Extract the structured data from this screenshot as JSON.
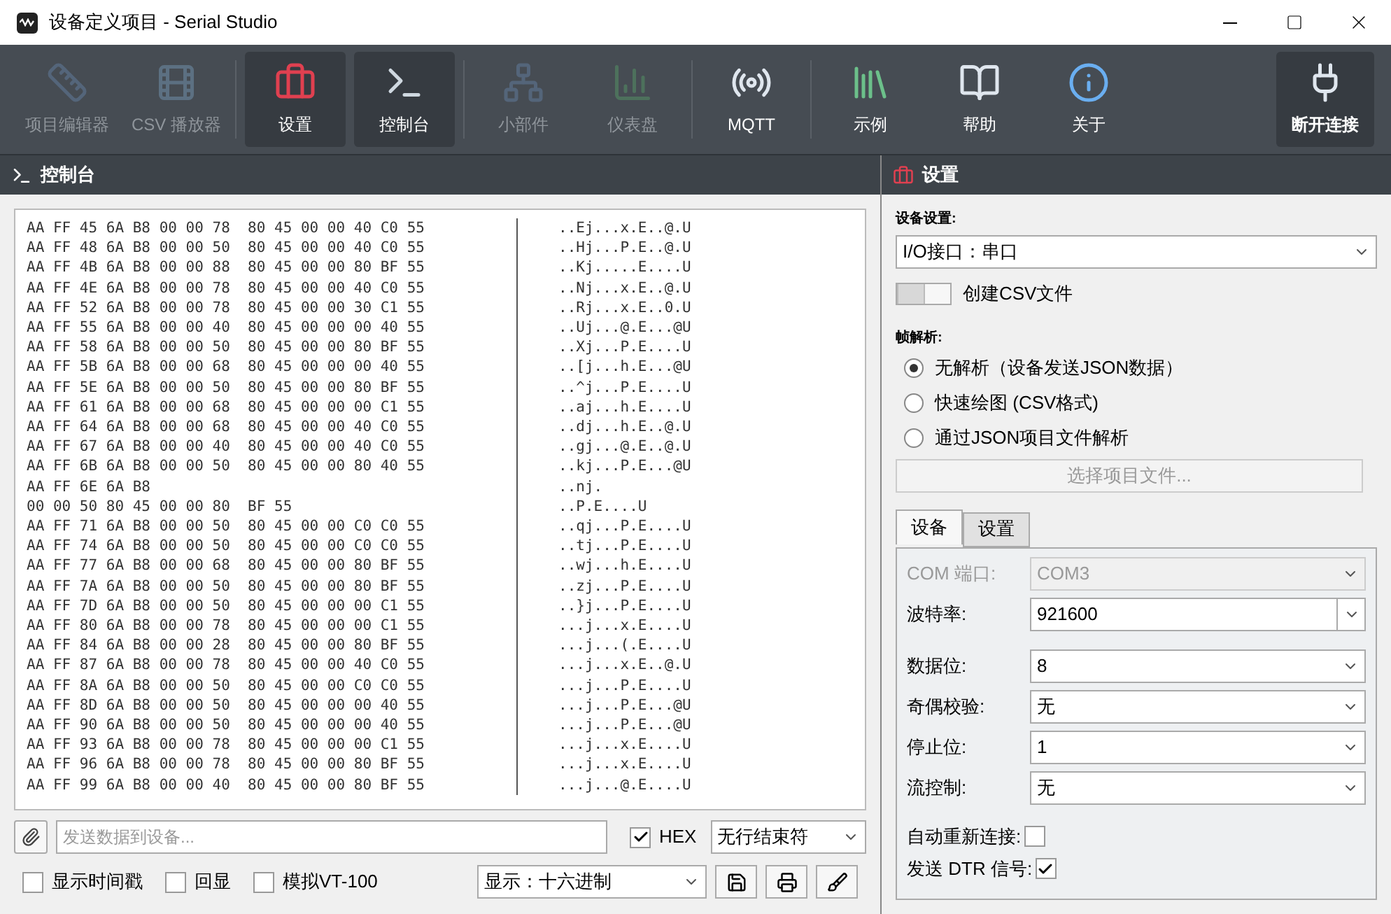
{
  "window": {
    "title": "设备定义项目 - Serial Studio"
  },
  "toolbar": {
    "items": [
      {
        "label": "项目编辑器",
        "disabled": true,
        "selected": false
      },
      {
        "label": "CSV 播放器",
        "disabled": true,
        "selected": false
      },
      {
        "label": "设置",
        "disabled": false,
        "selected": true
      },
      {
        "label": "控制台",
        "disabled": false,
        "selected": true
      },
      {
        "label": "小部件",
        "disabled": true,
        "selected": false
      },
      {
        "label": "仪表盘",
        "disabled": true,
        "selected": false
      },
      {
        "label": "MQTT",
        "disabled": false,
        "selected": false
      },
      {
        "label": "示例",
        "disabled": false,
        "selected": false
      },
      {
        "label": "帮助",
        "disabled": false,
        "selected": false
      },
      {
        "label": "关于",
        "disabled": false,
        "selected": false
      }
    ],
    "connect_button": {
      "label": "断开连接"
    }
  },
  "console": {
    "title": "控制台",
    "lines": [
      {
        "hex": "AA FF 45 6A B8 00 00 78  80 45 00 00 40 C0 55",
        "ascii": "..Ej...x.E..@.U"
      },
      {
        "hex": "AA FF 48 6A B8 00 00 50  80 45 00 00 40 C0 55",
        "ascii": "..Hj...P.E..@.U"
      },
      {
        "hex": "AA FF 4B 6A B8 00 00 88  80 45 00 00 80 BF 55",
        "ascii": "..Kj.....E....U"
      },
      {
        "hex": "AA FF 4E 6A B8 00 00 78  80 45 00 00 40 C0 55",
        "ascii": "..Nj...x.E..@.U"
      },
      {
        "hex": "AA FF 52 6A B8 00 00 78  80 45 00 00 30 C1 55",
        "ascii": "..Rj...x.E..0.U"
      },
      {
        "hex": "AA FF 55 6A B8 00 00 40  80 45 00 00 00 40 55",
        "ascii": "..Uj...@.E...@U"
      },
      {
        "hex": "AA FF 58 6A B8 00 00 50  80 45 00 00 80 BF 55",
        "ascii": "..Xj...P.E....U"
      },
      {
        "hex": "AA FF 5B 6A B8 00 00 68  80 45 00 00 00 40 55",
        "ascii": "..[j...h.E...@U"
      },
      {
        "hex": "AA FF 5E 6A B8 00 00 50  80 45 00 00 80 BF 55",
        "ascii": "..^j...P.E....U"
      },
      {
        "hex": "AA FF 61 6A B8 00 00 68  80 45 00 00 00 C1 55",
        "ascii": "..aj...h.E....U"
      },
      {
        "hex": "AA FF 64 6A B8 00 00 68  80 45 00 00 40 C0 55",
        "ascii": "..dj...h.E..@.U"
      },
      {
        "hex": "AA FF 67 6A B8 00 00 40  80 45 00 00 40 C0 55",
        "ascii": "..gj...@.E..@.U"
      },
      {
        "hex": "AA FF 6B 6A B8 00 00 50  80 45 00 00 80 40 55",
        "ascii": "..kj...P.E...@U"
      },
      {
        "hex": "AA FF 6E 6A B8",
        "ascii": "..nj."
      },
      {
        "hex": "00 00 50 80 45 00 00 80  BF 55",
        "ascii": "..P.E....U"
      },
      {
        "hex": "AA FF 71 6A B8 00 00 50  80 45 00 00 C0 C0 55",
        "ascii": "..qj...P.E....U"
      },
      {
        "hex": "AA FF 74 6A B8 00 00 50  80 45 00 00 C0 C0 55",
        "ascii": "..tj...P.E....U"
      },
      {
        "hex": "AA FF 77 6A B8 00 00 68  80 45 00 00 80 BF 55",
        "ascii": "..wj...h.E....U"
      },
      {
        "hex": "AA FF 7A 6A B8 00 00 50  80 45 00 00 80 BF 55",
        "ascii": "..zj...P.E....U"
      },
      {
        "hex": "AA FF 7D 6A B8 00 00 50  80 45 00 00 00 C1 55",
        "ascii": "..}j...P.E....U"
      },
      {
        "hex": "AA FF 80 6A B8 00 00 78  80 45 00 00 00 C1 55",
        "ascii": "...j...x.E....U"
      },
      {
        "hex": "AA FF 84 6A B8 00 00 28  80 45 00 00 80 BF 55",
        "ascii": "...j...(.E....U"
      },
      {
        "hex": "AA FF 87 6A B8 00 00 78  80 45 00 00 40 C0 55",
        "ascii": "...j...x.E..@.U"
      },
      {
        "hex": "AA FF 8A 6A B8 00 00 50  80 45 00 00 C0 C0 55",
        "ascii": "...j...P.E....U"
      },
      {
        "hex": "AA FF 8D 6A B8 00 00 50  80 45 00 00 00 40 55",
        "ascii": "...j...P.E...@U"
      },
      {
        "hex": "AA FF 90 6A B8 00 00 50  80 45 00 00 00 40 55",
        "ascii": "...j...P.E...@U"
      },
      {
        "hex": "AA FF 93 6A B8 00 00 78  80 45 00 00 00 C1 55",
        "ascii": "...j...x.E....U"
      },
      {
        "hex": "AA FF 96 6A B8 00 00 78  80 45 00 00 80 BF 55",
        "ascii": "...j...x.E....U"
      },
      {
        "hex": "AA FF 99 6A B8 00 00 40  80 45 00 00 80 BF 55",
        "ascii": "...j...@.E....U"
      }
    ],
    "send_field": {
      "placeholder": "发送数据到设备..."
    },
    "hex_checkbox": {
      "label": "HEX",
      "checked": true
    },
    "line_ending": {
      "value": "无行结束符"
    },
    "options": [
      {
        "label": "显示时间戳",
        "checked": false
      },
      {
        "label": "回显",
        "checked": false
      },
      {
        "label": "模拟VT-100",
        "checked": false
      }
    ],
    "display_mode": {
      "value": "显示：十六进制"
    }
  },
  "settings": {
    "title": "设置",
    "device_label": "设备设置:",
    "io_select": {
      "value": "I/O接口：串口"
    },
    "csv_switch": {
      "label": "创建CSV文件",
      "on": false
    },
    "frame_label": "帧解析:",
    "frame_options": [
      {
        "label": "无解析（设备发送JSON数据）",
        "selected": true
      },
      {
        "label": "快速绘图 (CSV格式)",
        "selected": false
      },
      {
        "label": "通过JSON项目文件解析",
        "selected": false
      }
    ],
    "project_button": {
      "label": "选择项目文件...",
      "disabled": true
    },
    "tabs": [
      {
        "label": "设备",
        "selected": true
      },
      {
        "label": "设置",
        "selected": false
      }
    ],
    "fields": [
      {
        "kind": "select",
        "label": "COM 端口:",
        "value": "COM3",
        "disabled": true
      },
      {
        "kind": "combo",
        "label": "波特率:",
        "value": "921600",
        "disabled": false
      },
      {
        "kind": "select",
        "label": "数据位:",
        "value": "8",
        "disabled": false
      },
      {
        "kind": "select",
        "label": "奇偶校验:",
        "value": "无",
        "disabled": false
      },
      {
        "kind": "select",
        "label": "停止位:",
        "value": "1",
        "disabled": false
      },
      {
        "kind": "select",
        "label": "流控制:",
        "value": "无",
        "disabled": false
      }
    ],
    "checks": [
      {
        "label": "自动重新连接:",
        "checked": false
      },
      {
        "label": "发送 DTR 信号:",
        "checked": true
      }
    ]
  }
}
